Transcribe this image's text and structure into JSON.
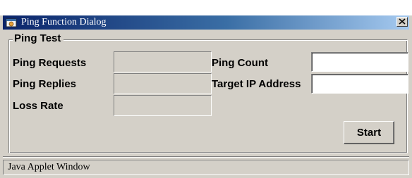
{
  "window": {
    "title": "Ping Function Dialog",
    "title_icon": "java-applet-icon",
    "close_label": "x",
    "close_icon": "close-icon"
  },
  "group": {
    "legend": "Ping Test"
  },
  "fields": {
    "ping_requests": {
      "label": "Ping Requests",
      "value": ""
    },
    "ping_replies": {
      "label": "Ping Replies",
      "value": ""
    },
    "loss_rate": {
      "label": "Loss Rate",
      "value": ""
    },
    "ping_count": {
      "label": "Ping Count",
      "value": "",
      "placeholder": ""
    },
    "target_ip": {
      "label": "Target IP Address",
      "value": "",
      "placeholder": ""
    }
  },
  "buttons": {
    "start_label": "Start"
  },
  "status_bar": {
    "text": "Java Applet Window"
  },
  "colors": {
    "dialog_background": "#d4d0c8",
    "title_bar_start": "#0a246a",
    "title_bar_end": "#a6caf0",
    "title_text": "#ffffff"
  }
}
